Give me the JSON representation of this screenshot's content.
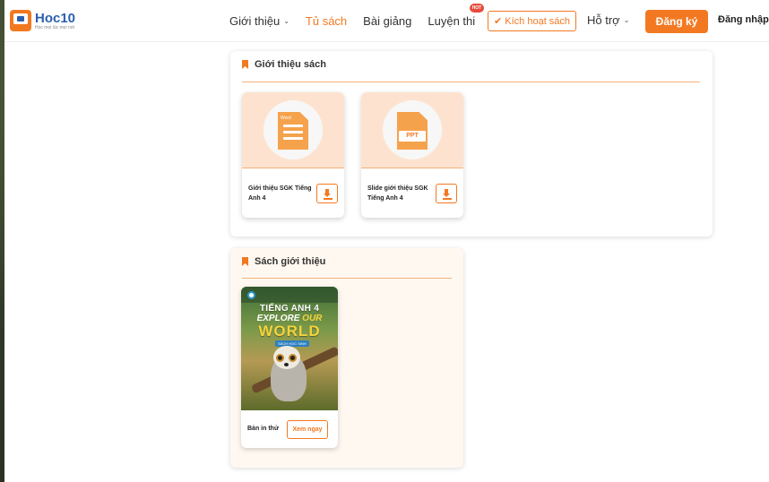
{
  "header": {
    "logo_name": "Hoc10",
    "logo_tagline": "Học mọi lúc mọi nơi",
    "nav": [
      {
        "label": "Giới thiệu",
        "has_dropdown": true
      },
      {
        "label": "Tủ sách",
        "active": true
      },
      {
        "label": "Bài giảng"
      },
      {
        "label": "Luyện thi",
        "badge": "HOT"
      }
    ],
    "activate_label": "✔ Kích hoạt sách",
    "support_label": "Hỗ trợ",
    "register_label": "Đăng ký",
    "login_label": "Đăng nhập"
  },
  "intro_section": {
    "title": "Giới thiệu sách",
    "files": [
      {
        "name": "Giới thiệu SGK Tiếng Anh 4",
        "icon": "word-doc-icon",
        "icon_label": "Word"
      },
      {
        "name": "Slide giới thiệu SGK Tiếng Anh 4",
        "icon": "ppt-icon",
        "icon_label": "PPT"
      }
    ]
  },
  "books_section": {
    "title": "Sách giới thiệu",
    "book": {
      "cover_title": "TIẾNG ANH 4",
      "cover_series_word1": "EXPLORE",
      "cover_series_word2": "OUR",
      "cover_series_word3": "WORLD",
      "cover_subtitle": "SÁCH HỌC SINH",
      "label": "Bản in thử",
      "view_label": "Xem ngay"
    }
  },
  "colors": {
    "accent": "#f27922",
    "brand_blue": "#2b5fae"
  }
}
